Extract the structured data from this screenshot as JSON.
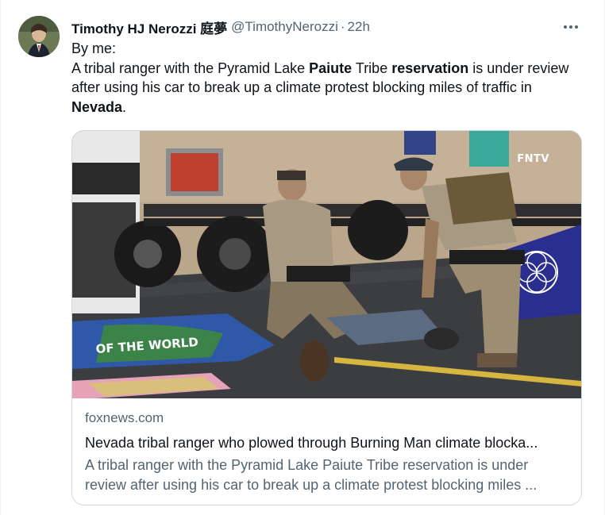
{
  "tweet": {
    "display_name": "Timothy HJ Nerozzi 庭夢",
    "handle": "@TimothyNerozzi",
    "separator": "·",
    "time": "22h",
    "line1": "By me:",
    "text_parts": [
      "A tribal ranger with the Pyramid Lake ",
      "Paiute",
      " Tribe ",
      "reservation",
      " is under review after using his car to break up a climate protest blocking miles of traffic in ",
      "Nevada",
      "."
    ]
  },
  "card": {
    "watermark": "FNTV",
    "sign_text": "OF THE WORLD",
    "domain": "foxnews.com",
    "title": "Nevada tribal ranger who plowed through Burning Man climate blocka...",
    "description": "A tribal ranger with the Pyramid Lake Paiute Tribe reservation is under review after using his car to break up a climate protest blocking miles ..."
  },
  "colors": {
    "text_primary": "#0f1419",
    "text_secondary": "#536471",
    "border": "#cfd9de",
    "flag_blue": "#2a2f8f"
  },
  "icons": {
    "more": "more-horizontal-icon"
  }
}
